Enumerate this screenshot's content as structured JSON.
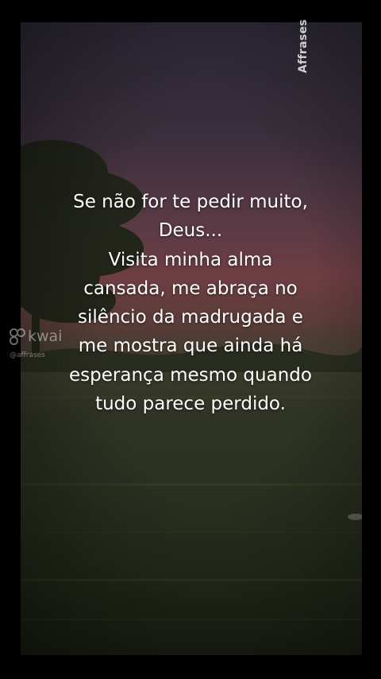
{
  "watermark": {
    "vertical_text": "Affrases",
    "kwai_brand": "kwai",
    "kwai_handle": "@affrases"
  },
  "quote": {
    "lines": [
      "Se não for te pedir muito,",
      "Deus...",
      "Visita minha alma",
      "cansada, me abraça no",
      "silêncio da madrugada e",
      "me mostra que ainda há",
      "esperança mesmo quando",
      "tudo parece perdido."
    ]
  },
  "colors": {
    "frame": "#000000",
    "sky_top": "#2e2a37",
    "sky_glow": "#6e3e44",
    "field": "#2a3020",
    "text": "#ffffff"
  }
}
